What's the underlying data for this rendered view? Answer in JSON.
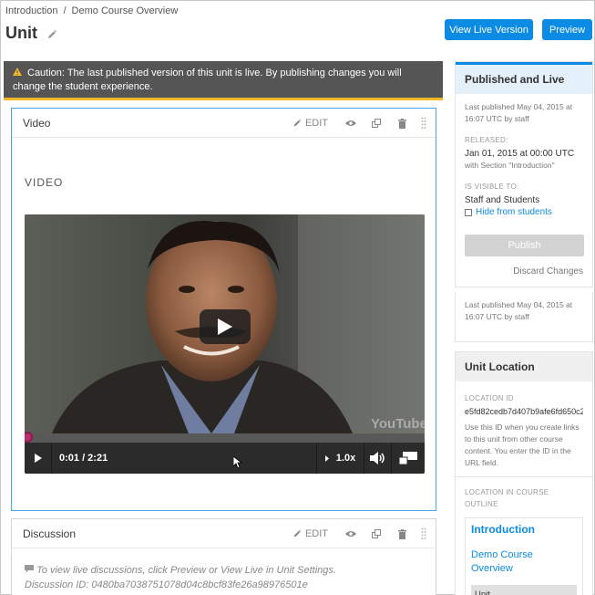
{
  "breadcrumb": {
    "section": "Introduction",
    "separator": "/",
    "subsection": "Demo Course Overview"
  },
  "page": {
    "title": "Unit"
  },
  "header_buttons": {
    "view_live": "View Live Version",
    "preview": "Preview"
  },
  "caution": {
    "text": "Caution: The last published version of this unit is live. By publishing changes you will change the student experience."
  },
  "video_block": {
    "name": "Video",
    "edit_label": "EDIT",
    "heading": "VIDEO",
    "watermark": "YouTube",
    "time": "0:01 / 2:21",
    "speed": "1.0x",
    "progress_percent": 1
  },
  "discussion_block": {
    "name": "Discussion",
    "edit_label": "EDIT",
    "line1": "To view live discussions, click Preview or View Live in Unit Settings.",
    "line2": "Discussion ID: 0480ba7038751078d04c8bcf83fe26a98976501e"
  },
  "publish_card": {
    "title": "Published and Live",
    "last_published": "Last published May 04, 2015 at 16:07 UTC by staff",
    "released_caption": "RELEASED:",
    "released_value": "Jan 01, 2015 at 00:00 UTC",
    "released_note": "with Section \"Introduction\"",
    "visible_caption": "IS VISIBLE TO:",
    "visible_value": "Staff and Students",
    "hide_label": "Hide from students",
    "publish_button": "Publish",
    "discard_label": "Discard Changes"
  },
  "last_card": {
    "text": "Last published May 04, 2015 at 16:07 UTC by staff"
  },
  "location_card": {
    "title": "Unit Location",
    "id_caption": "LOCATION ID",
    "id_value": "e5fd82cedb7d407b9afe6fd650c2",
    "id_help": "Use this ID when you create links to this unit from other course content. You enter the ID in the URL field.",
    "outline_caption": "LOCATION IN COURSE OUTLINE",
    "outline_section": "Introduction",
    "outline_subsection": "Demo Course Overview",
    "outline_unit": "Unit"
  },
  "colors": {
    "accent": "#0b8be4",
    "caution_bg": "#555555",
    "caution_stripe": "#f2b827",
    "progress_knob": "#bb2e6f"
  }
}
